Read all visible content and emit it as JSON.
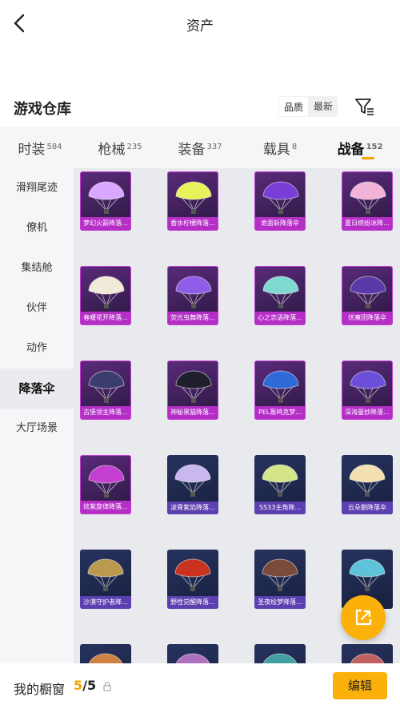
{
  "header": {
    "title": "资产"
  },
  "section": {
    "title": "游戏仓库",
    "sort_options": [
      "品质",
      "最新"
    ]
  },
  "tabs": [
    {
      "label": "时装",
      "count": "584"
    },
    {
      "label": "枪械",
      "count": "235"
    },
    {
      "label": "装备",
      "count": "337"
    },
    {
      "label": "载具",
      "count": "8"
    },
    {
      "label": "战备",
      "count": "152"
    }
  ],
  "sidebar": {
    "items": [
      {
        "label": "滑翔尾迹"
      },
      {
        "label": "僚机"
      },
      {
        "label": "集结舱"
      },
      {
        "label": "伙伴"
      },
      {
        "label": "动作"
      },
      {
        "label": "降落伞"
      },
      {
        "label": "大厅场景"
      }
    ]
  },
  "grid": {
    "items": [
      {
        "label": "梦幻火箭降落...",
        "style": "purple",
        "color": "#d9a7ff"
      },
      {
        "label": "香水柠檬降落...",
        "style": "purple",
        "color": "#e6f25a"
      },
      {
        "label": "诡面斩降落伞",
        "style": "purple",
        "color": "#7a3dd6"
      },
      {
        "label": "夏日缤纷冰降...",
        "style": "purple",
        "color": "#f2b3d9"
      },
      {
        "label": "春暖花开降落...",
        "style": "purple",
        "color": "#f2ead8"
      },
      {
        "label": "荧光虫舞降落...",
        "style": "purple",
        "color": "#8e5ce6"
      },
      {
        "label": "心之恋语降落...",
        "style": "purple",
        "color": "#7fd9d0"
      },
      {
        "label": "伏魔团降落伞",
        "style": "purple",
        "color": "#5a3aa6"
      },
      {
        "label": "古堡领主降落...",
        "style": "purple",
        "color": "#3b3d6e"
      },
      {
        "label": "神秘黑猫降落...",
        "style": "purple",
        "color": "#1f1f2b"
      },
      {
        "label": "PEL轰鸣克梦...",
        "style": "purple",
        "color": "#2f6ad9"
      },
      {
        "label": "深海曼妙降落...",
        "style": "purple",
        "color": "#6b4ed9"
      },
      {
        "label": "炫紫旋律降落...",
        "style": "purple",
        "color": "#c43fd0"
      },
      {
        "label": "凌霄紫焰降落...",
        "style": "blue",
        "color": "#c9b8ef"
      },
      {
        "label": "SS33主角降...",
        "style": "blue",
        "color": "#d5e68a"
      },
      {
        "label": "云朵鹅降落伞",
        "style": "blue",
        "color": "#f2e0b0"
      },
      {
        "label": "沙漠守护者降...",
        "style": "blue",
        "color": "#b99a4e"
      },
      {
        "label": "野性觉醒降落...",
        "style": "blue",
        "color": "#c8321f"
      },
      {
        "label": "圣夜绘梦降落...",
        "style": "blue",
        "color": "#7a4a3a"
      },
      {
        "label": "",
        "style": "blue",
        "color": "#5ec3d9"
      },
      {
        "label": "",
        "style": "blue",
        "color": "#d08040"
      },
      {
        "label": "",
        "style": "blue",
        "color": "#b070c0"
      },
      {
        "label": "",
        "style": "blue",
        "color": "#40a0a0"
      },
      {
        "label": "",
        "style": "blue",
        "color": "#c06060"
      }
    ]
  },
  "bottom": {
    "label": "我的橱窗",
    "current": "5",
    "total": "5",
    "edit_label": "编辑"
  },
  "colors": {
    "accent": "#fbb10a",
    "purple_frame": "#c23ed3",
    "blue_label": "#5c3fb0"
  },
  "icons": {
    "back": "chevron-left-icon",
    "filter": "filter-icon",
    "share": "share-out-icon",
    "lock": "lock-icon"
  }
}
